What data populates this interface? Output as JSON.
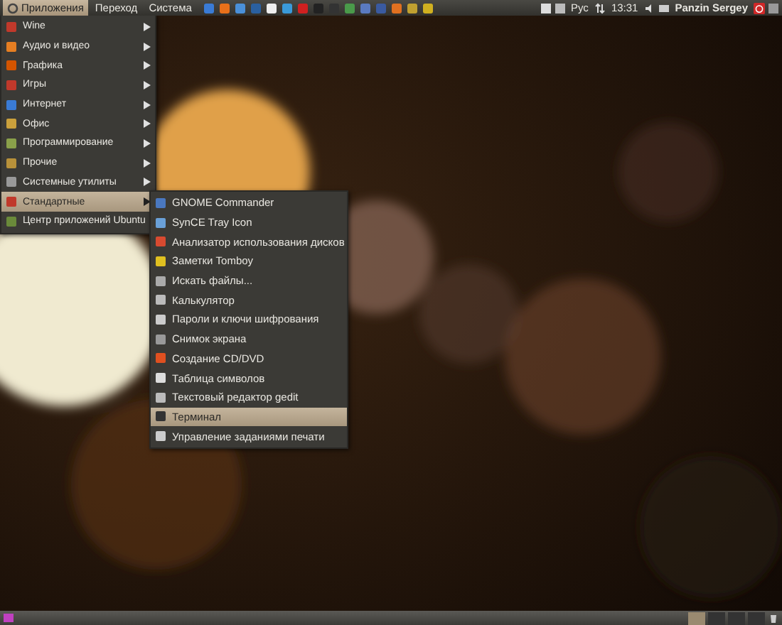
{
  "top_panel": {
    "menus": [
      {
        "label": "Приложения",
        "selected": true
      },
      {
        "label": "Переход",
        "selected": false
      },
      {
        "label": "Система",
        "selected": false
      }
    ],
    "keyboard_layout": "Рус",
    "clock": "13:31",
    "user": "Panzin Sergey"
  },
  "applications_menu": {
    "items": [
      {
        "label": "Wine",
        "has_submenu": true,
        "selected": false
      },
      {
        "label": "Аудио и видео",
        "has_submenu": true,
        "selected": false
      },
      {
        "label": "Графика",
        "has_submenu": true,
        "selected": false
      },
      {
        "label": "Игры",
        "has_submenu": true,
        "selected": false
      },
      {
        "label": "Интернет",
        "has_submenu": true,
        "selected": false
      },
      {
        "label": "Офис",
        "has_submenu": true,
        "selected": false
      },
      {
        "label": "Программирование",
        "has_submenu": true,
        "selected": false
      },
      {
        "label": "Прочие",
        "has_submenu": true,
        "selected": false
      },
      {
        "label": "Системные утилиты",
        "has_submenu": true,
        "selected": false
      },
      {
        "label": "Стандартные",
        "has_submenu": true,
        "selected": true
      },
      {
        "label": "Центр приложений Ubuntu",
        "selected": false
      }
    ]
  },
  "accessories_menu": {
    "items": [
      {
        "label": "GNOME Commander",
        "selected": false
      },
      {
        "label": "SynCE Tray Icon",
        "selected": false
      },
      {
        "label": "Анализатор использования дисков",
        "selected": false
      },
      {
        "label": "Заметки Tomboy",
        "selected": false
      },
      {
        "label": "Искать файлы...",
        "selected": false
      },
      {
        "label": "Калькулятор",
        "selected": false
      },
      {
        "label": "Пароли и ключи шифрования",
        "selected": false
      },
      {
        "label": "Снимок экрана",
        "selected": false
      },
      {
        "label": "Создание CD/DVD",
        "selected": false
      },
      {
        "label": "Таблица символов",
        "selected": false
      },
      {
        "label": "Текстовый редактор gedit",
        "selected": false
      },
      {
        "label": "Терминал",
        "selected": true
      },
      {
        "label": "Управление заданиями печати",
        "selected": false
      }
    ]
  }
}
